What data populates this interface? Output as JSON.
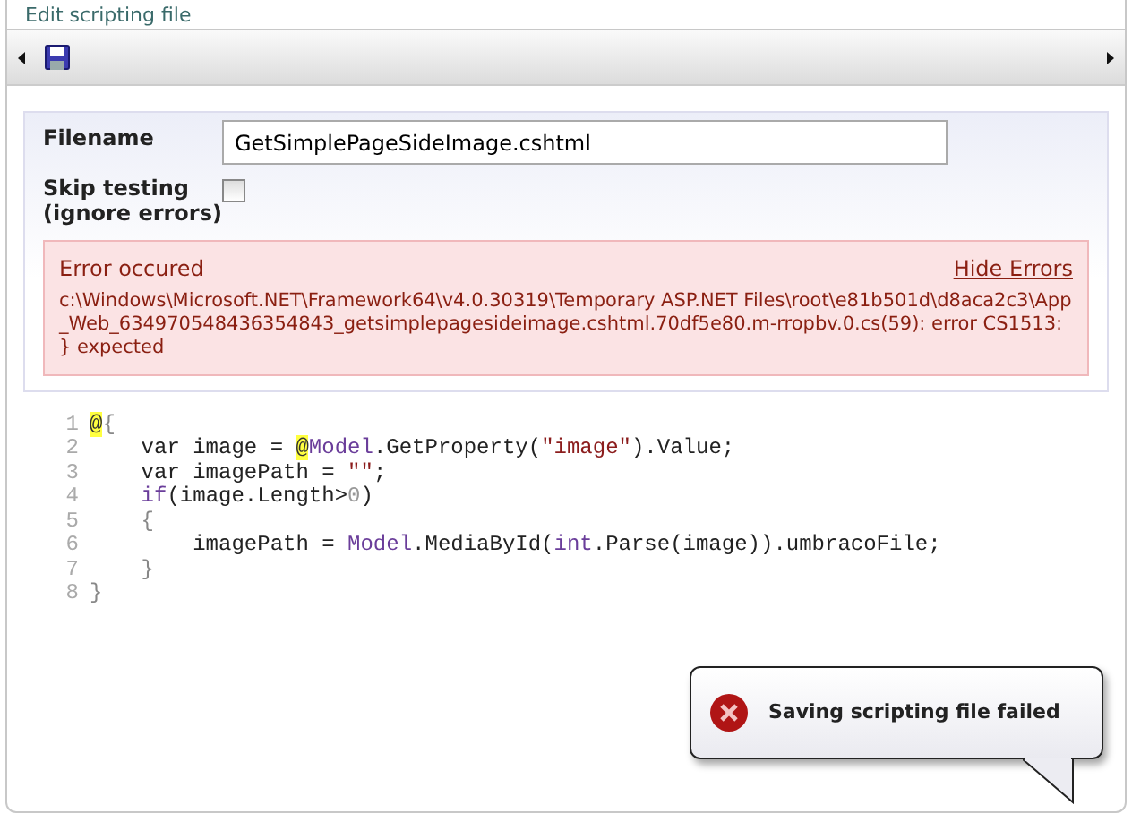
{
  "window": {
    "title": "Edit scripting file"
  },
  "form": {
    "filename_label": "Filename",
    "filename_value": "GetSimplePageSideImage.cshtml",
    "skip_label": "Skip testing",
    "skip_hint": "(ignore errors)",
    "skip_checked": false
  },
  "error": {
    "title": "Error occured",
    "hide_link": "Hide Errors",
    "message": "c:\\Windows\\Microsoft.NET\\Framework64\\v4.0.30319\\Temporary ASP.NET Files\\root\\e81b501d\\d8aca2c3\\App_Web_634970548436354843_getsimplepagesideimage.cshtml.70df5e80.m-rropbv.0.cs(59): error CS1513: } expected"
  },
  "code": [
    {
      "number": "1",
      "tokens": [
        {
          "text": "@",
          "kind": "highlight"
        },
        {
          "text": "{",
          "kind": "bracket"
        }
      ]
    },
    {
      "number": "2",
      "tokens": [
        {
          "text": "    var image = ",
          "kind": "plain"
        },
        {
          "text": "@",
          "kind": "highlight"
        },
        {
          "text": "Model",
          "kind": "model"
        },
        {
          "text": ".GetProperty(",
          "kind": "plain"
        },
        {
          "text": "\"image\"",
          "kind": "string"
        },
        {
          "text": ").Value;",
          "kind": "plain"
        }
      ]
    },
    {
      "number": "3",
      "tokens": [
        {
          "text": "    var imagePath = ",
          "kind": "plain"
        },
        {
          "text": "\"\"",
          "kind": "string"
        },
        {
          "text": ";",
          "kind": "plain"
        }
      ]
    },
    {
      "number": "4",
      "tokens": [
        {
          "text": "    if",
          "kind": "model"
        },
        {
          "text": "(image.Length>",
          "kind": "plain"
        },
        {
          "text": "0",
          "kind": "number"
        },
        {
          "text": ")",
          "kind": "plain"
        }
      ]
    },
    {
      "number": "5",
      "tokens": [
        {
          "text": "    {",
          "kind": "bracket"
        }
      ]
    },
    {
      "number": "6",
      "tokens": [
        {
          "text": "        imagePath = ",
          "kind": "plain"
        },
        {
          "text": "Model",
          "kind": "model"
        },
        {
          "text": ".MediaById(",
          "kind": "plain"
        },
        {
          "text": "int",
          "kind": "model"
        },
        {
          "text": ".Parse(image)).umbracoFile;",
          "kind": "plain"
        }
      ]
    },
    {
      "number": "7",
      "tokens": [
        {
          "text": "    }",
          "kind": "bracket"
        }
      ]
    },
    {
      "number": "8",
      "tokens": [
        {
          "text": "}",
          "kind": "bracket"
        }
      ]
    }
  ],
  "toast": {
    "message": "Saving scripting file failed"
  }
}
